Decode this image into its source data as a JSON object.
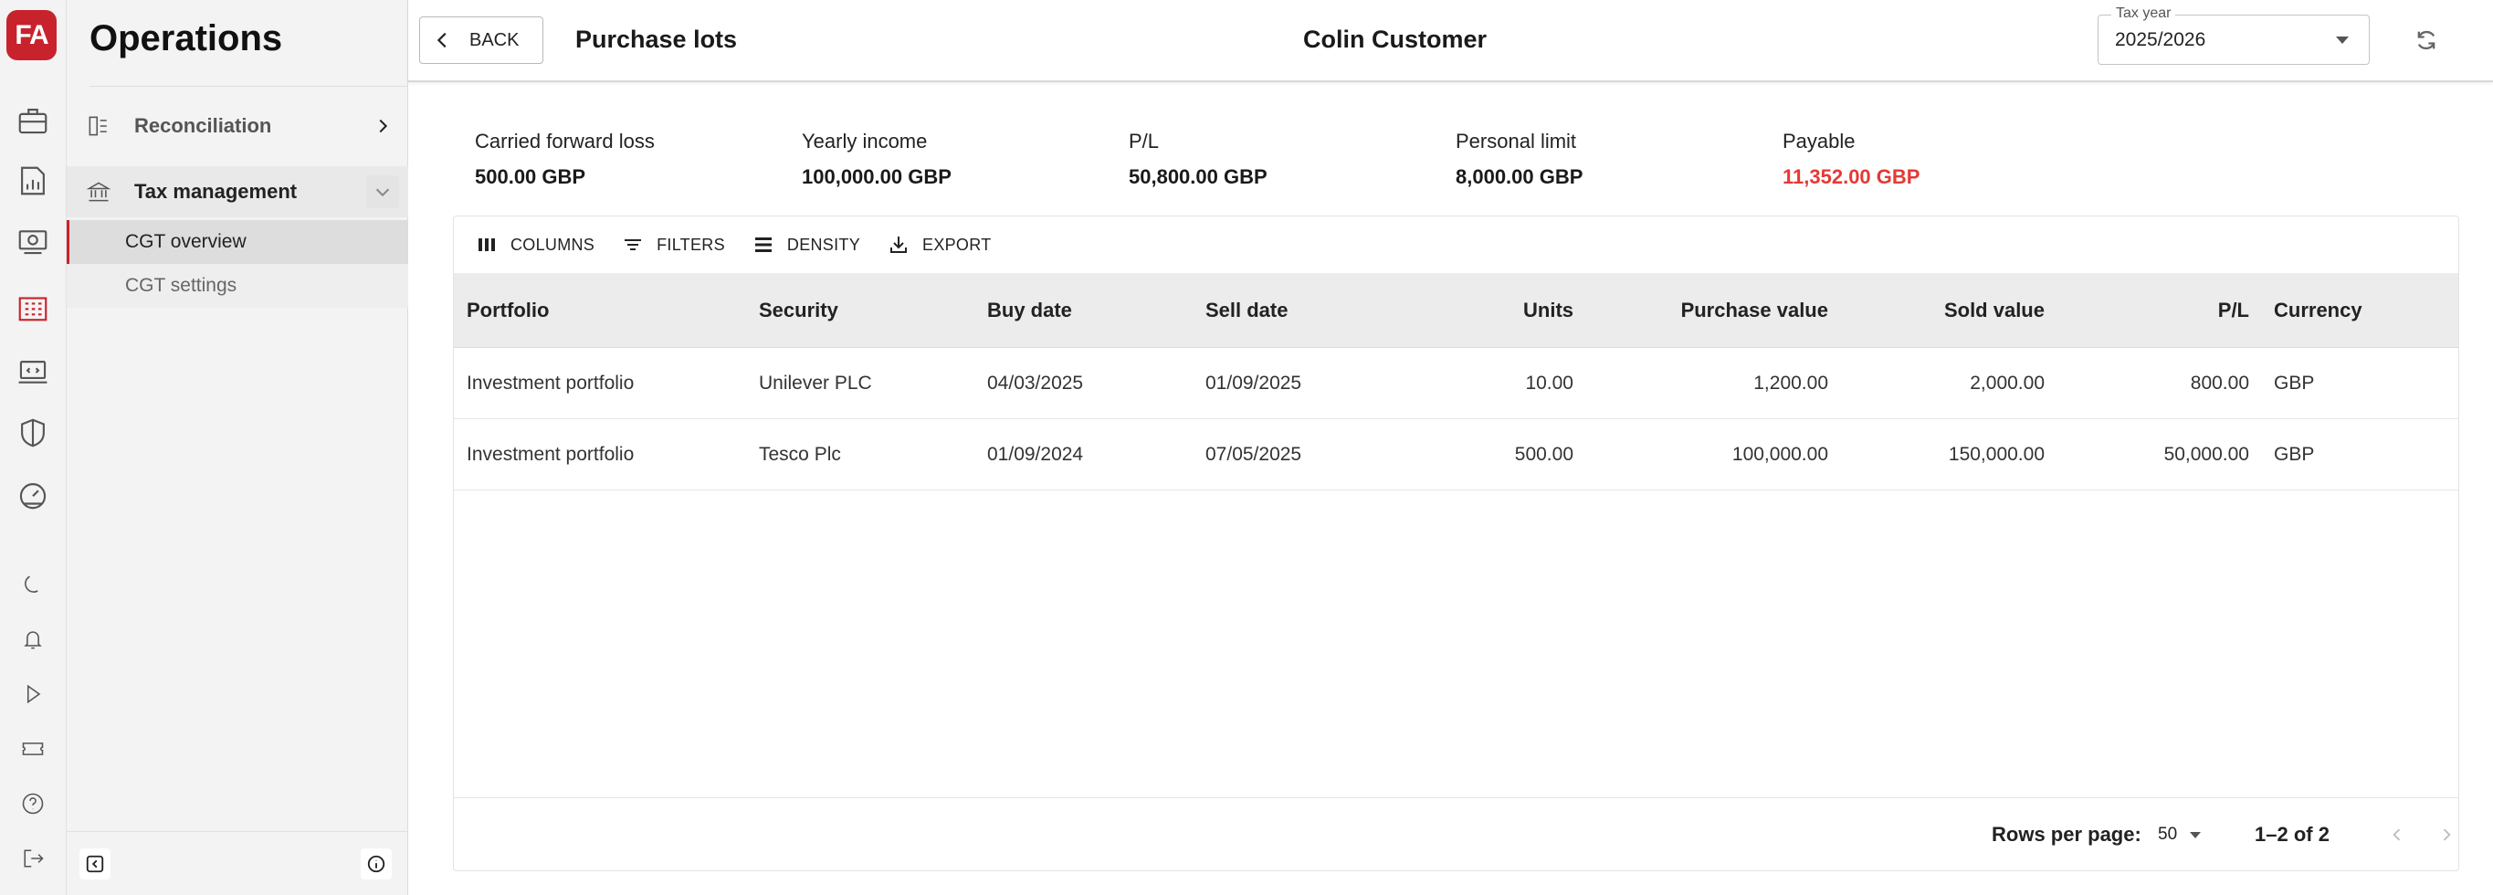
{
  "app": {
    "logo_text": "FA",
    "section_title": "Operations"
  },
  "rail": {
    "icons": [
      "briefcase-icon",
      "reports-icon",
      "money-icon",
      "building-icon",
      "monitor-icon",
      "shield-icon",
      "speedometer-icon",
      "moon-icon",
      "bell-icon",
      "play-icon",
      "ticket-icon",
      "help-icon",
      "logout-icon"
    ]
  },
  "nav": {
    "groups": [
      {
        "label": "Reconciliation",
        "icon": "reconciliation-icon",
        "expanded": false
      },
      {
        "label": "Tax management",
        "icon": "bank-icon",
        "expanded": true
      }
    ],
    "sub_items": [
      {
        "label": "CGT overview",
        "active": true
      },
      {
        "label": "CGT settings",
        "active": false
      }
    ]
  },
  "header": {
    "back_label": "BACK",
    "page_title": "Purchase lots",
    "customer_name": "Colin Customer",
    "tax_year_label": "Tax year",
    "tax_year_value": "2025/2026"
  },
  "summary": [
    {
      "label": "Carried forward loss",
      "value": "500.00 GBP"
    },
    {
      "label": "Yearly income",
      "value": "100,000.00 GBP"
    },
    {
      "label": "P/L",
      "value": "50,800.00 GBP"
    },
    {
      "label": "Personal limit",
      "value": "8,000.00 GBP"
    },
    {
      "label": "Payable",
      "value": "11,352.00 GBP"
    }
  ],
  "colors": {
    "brand": "#c8232c",
    "payable": "#e53935"
  },
  "toolbar": {
    "columns": "COLUMNS",
    "filters": "FILTERS",
    "density": "DENSITY",
    "export": "EXPORT"
  },
  "table": {
    "columns": [
      "Portfolio",
      "Security",
      "Buy date",
      "Sell date",
      "Units",
      "Purchase value",
      "Sold value",
      "P/L",
      "Currency"
    ],
    "rows": [
      [
        "Investment portfolio",
        "Unilever PLC",
        "04/03/2025",
        "01/09/2025",
        "10.00",
        "1,200.00",
        "2,000.00",
        "800.00",
        "GBP"
      ],
      [
        "Investment portfolio",
        "Tesco Plc",
        "01/09/2024",
        "07/05/2025",
        "500.00",
        "100,000.00",
        "150,000.00",
        "50,000.00",
        "GBP"
      ]
    ]
  },
  "pagination": {
    "rows_per_page_label": "Rows per page:",
    "rows_per_page": "50",
    "range": "1–2 of 2"
  }
}
